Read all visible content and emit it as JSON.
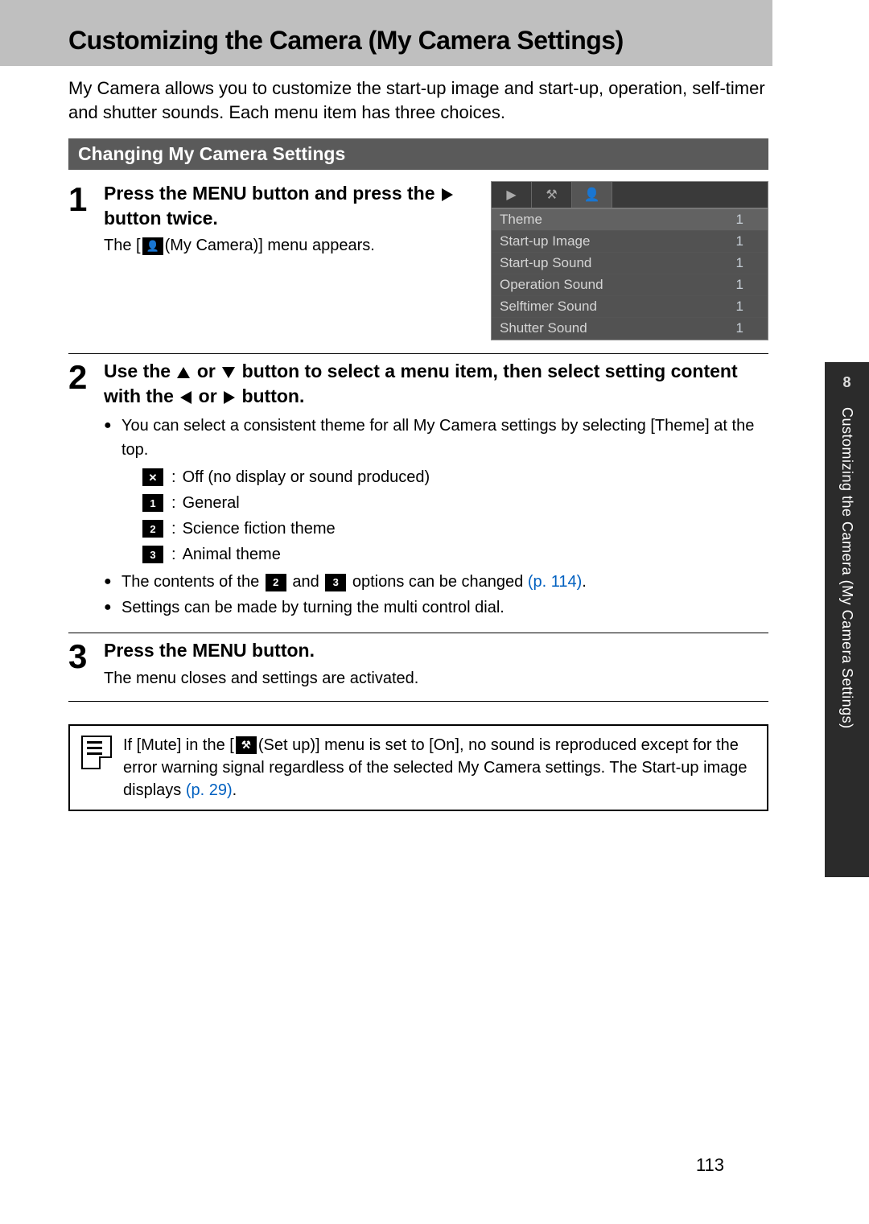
{
  "title": "Customizing the Camera (My Camera Settings)",
  "intro": "My Camera allows you to customize the start-up image and start-up, operation, self-timer and shutter sounds. Each menu item has three choices.",
  "section_header": "Changing My Camera Settings",
  "side": {
    "chapter": "8",
    "label": "Customizing the Camera (My Camera Settings)"
  },
  "steps": {
    "s1": {
      "num": "1",
      "head_a": "Press the MENU button and press the",
      "head_b": "button twice.",
      "sub_a": "The [",
      "sub_b": "(My Camera)] menu appears."
    },
    "s2": {
      "num": "2",
      "head_a": "Use the",
      "head_b": "or",
      "head_c": "button to select a menu item, then select setting content with the",
      "head_d": "or",
      "head_e": "button.",
      "bullet1": "You can select a consistent theme for all My Camera settings by selecting [Theme] at the top.",
      "themes": {
        "off": "Off (no display or sound produced)",
        "general": "General",
        "scifi": "Science fiction theme",
        "animal": "Animal theme"
      },
      "bullet2_a": "The contents of the",
      "bullet2_b": "and",
      "bullet2_c": "options can be changed",
      "bullet2_ref": "(p. 114)",
      "bullet2_d": ".",
      "bullet3": "Settings can be made by turning the multi control dial."
    },
    "s3": {
      "num": "3",
      "head": "Press the MENU button.",
      "sub": "The menu closes and settings are activated."
    }
  },
  "screenshot": {
    "rows": [
      {
        "label": "Theme",
        "val": "1"
      },
      {
        "label": "Start-up Image",
        "val": "1"
      },
      {
        "label": "Start-up Sound",
        "val": "1"
      },
      {
        "label": "Operation Sound",
        "val": "1"
      },
      {
        "label": "Selftimer Sound",
        "val": "1"
      },
      {
        "label": "Shutter Sound",
        "val": "1"
      }
    ]
  },
  "note": {
    "text_a": "If [Mute] in the [",
    "text_b": "(Set up)] menu is set to [On], no sound is reproduced except for the error warning signal regardless of the selected My Camera settings. The Start-up image displays",
    "ref": "(p. 29)",
    "text_c": "."
  },
  "page_number": "113",
  "icon_labels": {
    "off": "✕",
    "one": "1",
    "two": "2",
    "three": "3",
    "person": "👤",
    "tools": "⚒"
  }
}
